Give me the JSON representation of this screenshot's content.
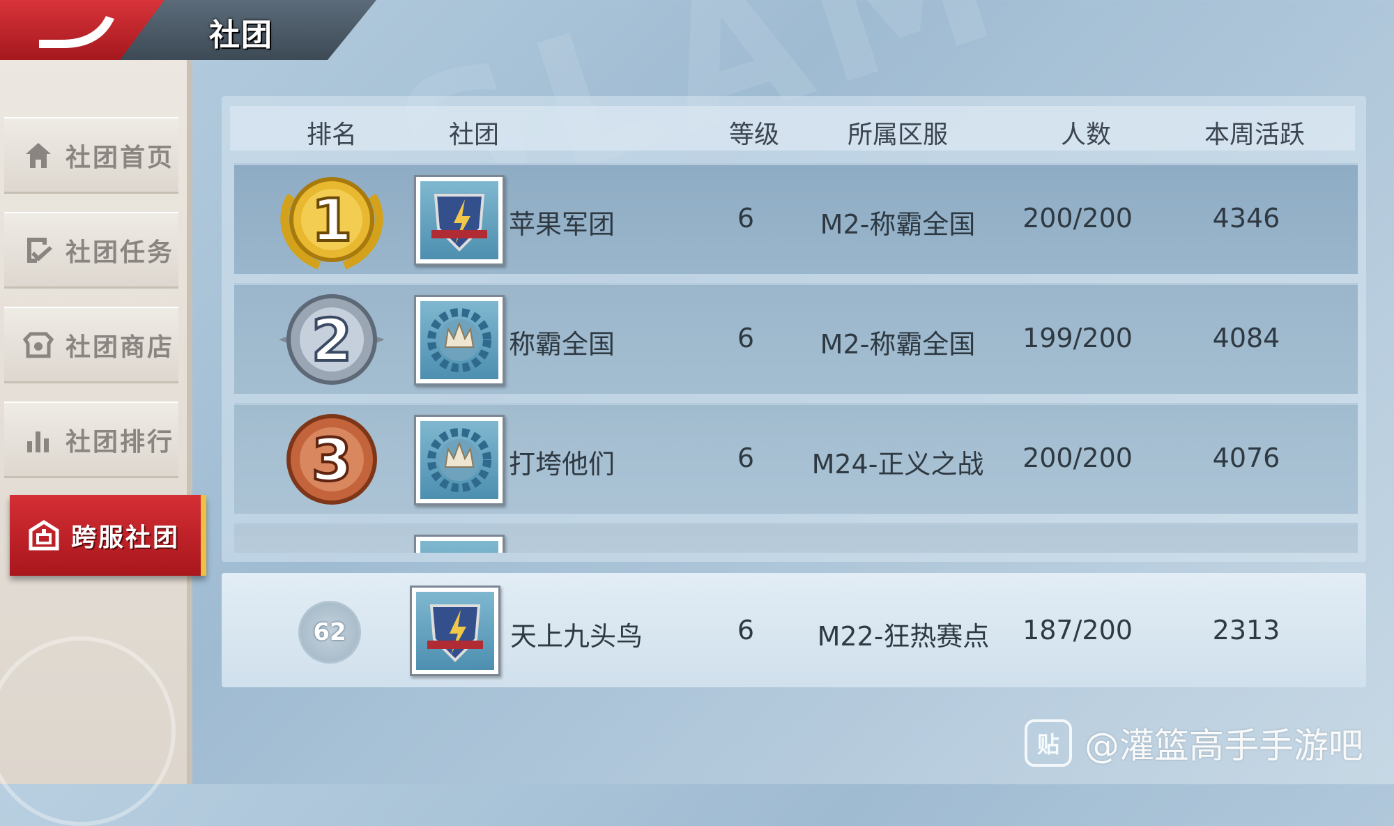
{
  "header": {
    "title": "社团"
  },
  "sidebar": {
    "items": [
      {
        "label": "社团首页",
        "icon": "home-icon"
      },
      {
        "label": "社团任务",
        "icon": "task-check-icon"
      },
      {
        "label": "社团商店",
        "icon": "shop-icon"
      },
      {
        "label": "社团排行",
        "icon": "bar-chart-icon"
      },
      {
        "label": "跨服社团",
        "icon": "cross-server-icon",
        "active": true
      }
    ]
  },
  "table": {
    "headers": {
      "rank": "排名",
      "club": "社团",
      "level": "等级",
      "server": "所属区服",
      "members": "人数",
      "activity": "本周活跃"
    },
    "rows": [
      {
        "rank": "1",
        "medal": "gold",
        "emblem": "eagle-emblem",
        "name": "苹果军团",
        "level": "6",
        "server": "M2-称霸全国",
        "members": "200/200",
        "activity": "4346"
      },
      {
        "rank": "2",
        "medal": "silver",
        "emblem": "crown-gear-emblem",
        "name": "称霸全国",
        "level": "6",
        "server": "M2-称霸全国",
        "members": "199/200",
        "activity": "4084"
      },
      {
        "rank": "3",
        "medal": "bronze",
        "emblem": "crown-gear-emblem",
        "name": "打垮他们",
        "level": "6",
        "server": "M24-正义之战",
        "members": "200/200",
        "activity": "4076"
      }
    ]
  },
  "my_club": {
    "rank": "62",
    "emblem": "eagle-emblem",
    "name": "天上九头鸟",
    "level": "6",
    "server": "M22-狂热赛点",
    "members": "187/200",
    "activity": "2313"
  },
  "watermark": {
    "icon_text": "贴",
    "text": "@灌篮高手手游吧"
  },
  "colors": {
    "accent_red": "#c4232a",
    "gold": "#e8b830",
    "silver": "#9aa6b4",
    "bronze": "#c4643c"
  }
}
